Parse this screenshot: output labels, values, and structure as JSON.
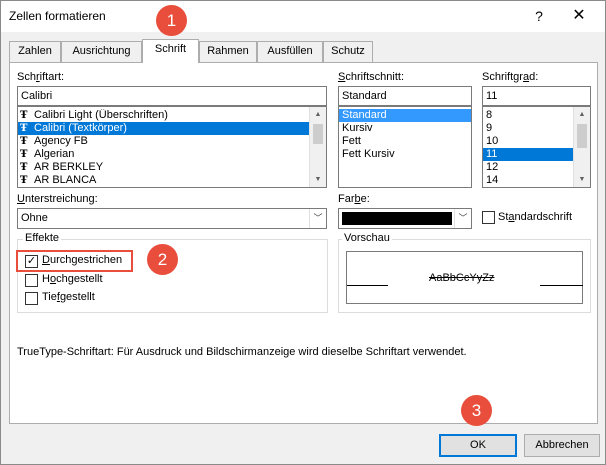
{
  "window": {
    "title": "Zellen formatieren",
    "help_label": "?",
    "close_label": "✕"
  },
  "tabs": [
    {
      "label": "Zahlen"
    },
    {
      "label": "Ausrichtung"
    },
    {
      "label": "Schrift"
    },
    {
      "label": "Rahmen"
    },
    {
      "label": "Ausfüllen"
    },
    {
      "label": "Schutz"
    }
  ],
  "font": {
    "label_pre": "Sch",
    "label_u": "r",
    "label_post": "iftart:",
    "value": "Calibri",
    "items": [
      {
        "label": "Calibri Light (Überschriften)"
      },
      {
        "label": "Calibri (Textkörper)"
      },
      {
        "label": "Agency FB"
      },
      {
        "label": "Algerian"
      },
      {
        "label": "AR BERKLEY"
      },
      {
        "label": "AR BLANCA"
      }
    ],
    "selected_index": 1
  },
  "style": {
    "label_pre": "",
    "label_u": "S",
    "label_post": "chriftschnitt:",
    "value": "Standard",
    "items": [
      {
        "label": "Standard"
      },
      {
        "label": "Kursiv"
      },
      {
        "label": "Fett"
      },
      {
        "label": "Fett Kursiv"
      }
    ],
    "selected_index": 0
  },
  "size": {
    "label_pre": "Schriftgr",
    "label_u": "a",
    "label_post": "d:",
    "value": "11",
    "items": [
      {
        "label": "8"
      },
      {
        "label": "9"
      },
      {
        "label": "10"
      },
      {
        "label": "11"
      },
      {
        "label": "12"
      },
      {
        "label": "14"
      }
    ],
    "selected_index": 3
  },
  "underline": {
    "label_pre": "",
    "label_u": "U",
    "label_post": "nterstreichung:",
    "value": "Ohne"
  },
  "color": {
    "label_pre": "Far",
    "label_u": "b",
    "label_post": "e:",
    "value": "#000000"
  },
  "standard_font": {
    "label_pre": "St",
    "label_u": "a",
    "label_post": "ndardschrift",
    "checked": false
  },
  "effects": {
    "title": "Effekte",
    "items": [
      {
        "label_pre": "",
        "label_u": "D",
        "label_post": "urchgestrichen",
        "checked": true
      },
      {
        "label_pre": "H",
        "label_u": "o",
        "label_post": "chgestellt",
        "checked": false
      },
      {
        "label_pre": "Tie",
        "label_u": "f",
        "label_post": "gestellt",
        "checked": false
      }
    ]
  },
  "preview": {
    "title": "Vorschau",
    "sample": "AaBbCcYyZz"
  },
  "info_text": "TrueType-Schriftart: Für Ausdruck und Bildschirmanzeige wird dieselbe Schriftart verwendet.",
  "buttons": {
    "ok": "OK",
    "cancel": "Abbrechen"
  },
  "callouts": [
    {
      "number": "1"
    },
    {
      "number": "2"
    },
    {
      "number": "3"
    }
  ],
  "accent_color": "#e94d3b",
  "selection_color": "#3399ff",
  "icons": {
    "font_type": "truetype-icon",
    "chevron": "chevron-down-icon"
  }
}
